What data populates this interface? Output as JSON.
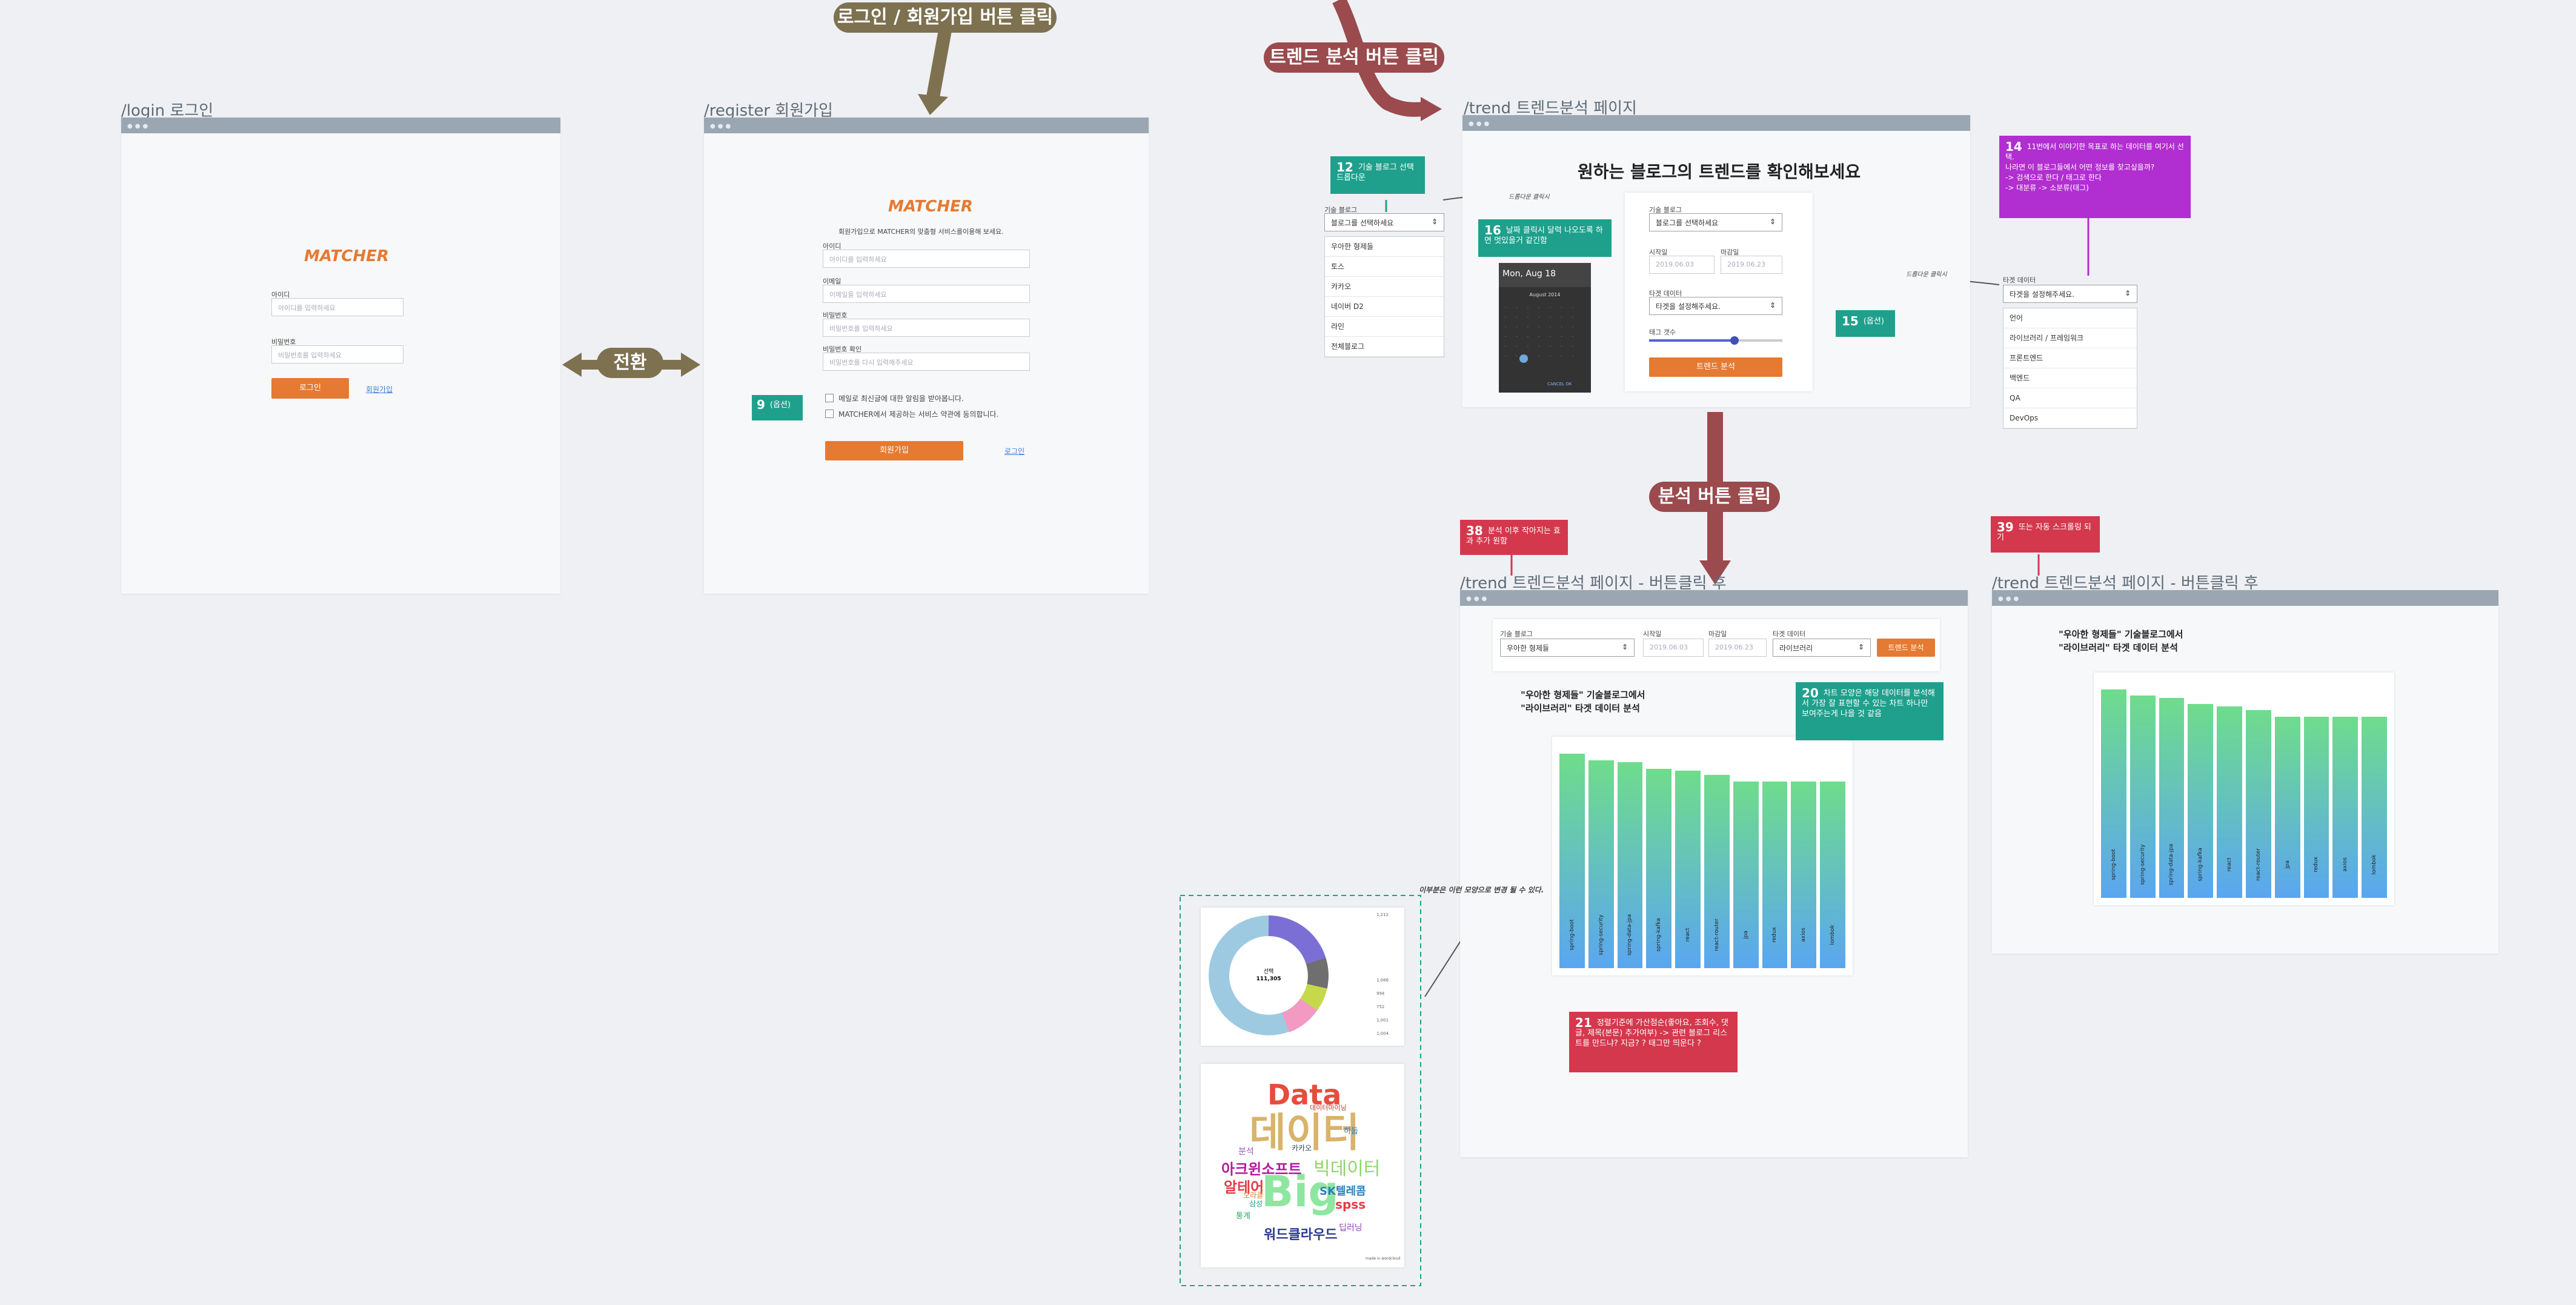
{
  "pills": {
    "login_register": "로그인 / 회원가입 버튼 클릭",
    "trend": "트렌드 분석 버튼 클릭",
    "switch": "전환",
    "analyze": "분석 버튼 클릭"
  },
  "frames": {
    "login": "/login 로그인",
    "register": "/register 회원가입",
    "trend": "/trend 트렌드분석 페이지",
    "after1": "/trend 트렌드분석 페이지 - 버튼클릭 후",
    "after2": "/trend 트렌드분석 페이지 - 버튼클릭 후"
  },
  "brand": "MATCHER",
  "login": {
    "id_label": "아이디",
    "id_ph": "아이디를 입력하세요",
    "pw_label": "비밀번호",
    "pw_ph": "비밀번호를 입력하세요",
    "login_btn": "로그인",
    "register_link": "회원가입"
  },
  "register": {
    "intro": "회원가입으로 MATCHER의 맞춤형 서비스를이용해 보세요.",
    "id_label": "아이디",
    "id_ph": "아이디를 입력하세요",
    "email_label": "이메일",
    "email_ph": "이메일을 입력하세요",
    "pw_label": "비밀번호",
    "pw_ph": "비밀번호를 입력하세요",
    "pw2_label": "비밀번호 확인",
    "pw2_ph": "비밀번호를 다시 입력해주세요",
    "check1": "메일로 최신글에 대한 알림을 받아봅니다.",
    "check2": "MATCHER에서 제공하는 서비스 약관에 동의합니다.",
    "submit": "회원가입",
    "login_link": "로그인"
  },
  "notes": {
    "n9": {
      "num": "9",
      "text": "(옵션)"
    },
    "n12": {
      "num": "12",
      "text": "기술 블로그 선택 드롭다운"
    },
    "n14": {
      "num": "14",
      "text": "11번에서 이야기한 목표로 하는 데이터를 여기서 선택.\n나라면 이 블로그들에서 어떤 정보를 찾고싶을까?\n-> 검색으로 한다 / 태그로 한다\n-> 대분류 -> 소분류(태그)"
    },
    "n15": {
      "num": "15",
      "text": "(옵션)"
    },
    "n16": {
      "num": "16",
      "text": "날짜 클릭시 달력 나오도록 하면 멋있을거 같긴함"
    },
    "n20": {
      "num": "20",
      "text": "차트 모양은 해당 데이터를 분석해서 가장 잘 표현할 수 있는 차트 하나만 보여주는게 나을 것 같음"
    },
    "n21": {
      "num": "21",
      "text": "정렬기준에 가산점순(좋아요, 조회수, 댓글, 제목(본문) 추가여부) -> 관련 블로그 리스트를 만드냐? 지금? ? 태그만 띄운다 ?"
    },
    "n38": {
      "num": "38",
      "text": "분석 이후 작아지는 효과 추가 원함"
    },
    "n39": {
      "num": "39",
      "text": "또는 자동 스크롤링 되기"
    }
  },
  "trend": {
    "heading": "원하는 블로그의 트렌드를 확인해보세요",
    "blog_label": "기술 블로그",
    "blog_ph": "블로그를 선택하세요",
    "start_label": "시작일",
    "end_label": "마감일",
    "start_val": "2019.06.03",
    "end_val": "2019.06.23",
    "target_label": "타겟 데이터",
    "target_ph": "타겟을 설정해주세요.",
    "tag_label": "태그 갯수",
    "analyze_btn": "트렌드 분석",
    "dropdown_hint": "드롭다운 클릭시",
    "blog_items": [
      "우아한 형제들",
      "토스",
      "카카오",
      "네이버 D2",
      "라인",
      "전체블로그"
    ],
    "target_items": [
      "언어",
      "라이브러리 / 프레임워크",
      "프론트엔드",
      "백엔드",
      "QA",
      "DevOps"
    ],
    "calendar": {
      "title": "Mon, Aug 18",
      "month": "August 2014",
      "ok": "CANCEL  OK"
    }
  },
  "after": {
    "blog_val": "우아한 형제들",
    "target_val": "라이브러리",
    "title1": "\"우아한 형제들\" 기술블로그에서",
    "title2": "\"라이브러리\" 타겟 데이터 분석",
    "chart_note": "이부분은 이런 모양으로 변경 될 수 있다."
  },
  "wordcloud": {
    "words": [
      "데이터",
      "Data",
      "Big",
      "빅데이터",
      "SK텔레콤",
      "아크윈소프트",
      "워드클라우드",
      "spss",
      "알테어",
      "분석",
      "삼성",
      "오라클",
      "카카오",
      "데이터마이닝",
      "딥러닝",
      "통계",
      "하둡"
    ],
    "credit": "made in wordcloud"
  },
  "donut_legend": [
    "선택",
    "111,305",
    "1,212",
    "1,066",
    "994",
    "752",
    "1,001",
    "1,004"
  ],
  "chart_data": [
    {
      "type": "bar",
      "categories": [
        "spring-boot",
        "spring-security",
        "spring-data-jpa",
        "spring-kafka",
        "react",
        "react-router",
        "jpa",
        "redux",
        "axios",
        "lombok"
      ],
      "values": [
        100,
        97,
        96,
        93,
        92,
        90,
        87,
        87,
        87,
        87
      ],
      "title": "",
      "xlabel": "",
      "ylabel": ""
    },
    {
      "type": "bar",
      "categories": [
        "spring-boot",
        "spring-security",
        "spring-data-jpa",
        "spring-kafka",
        "react",
        "react-router",
        "jpa",
        "redux",
        "axios",
        "lombok"
      ],
      "values": [
        100,
        97,
        96,
        93,
        92,
        90,
        87,
        87,
        87,
        87
      ],
      "title": "",
      "xlabel": "",
      "ylabel": ""
    }
  ]
}
